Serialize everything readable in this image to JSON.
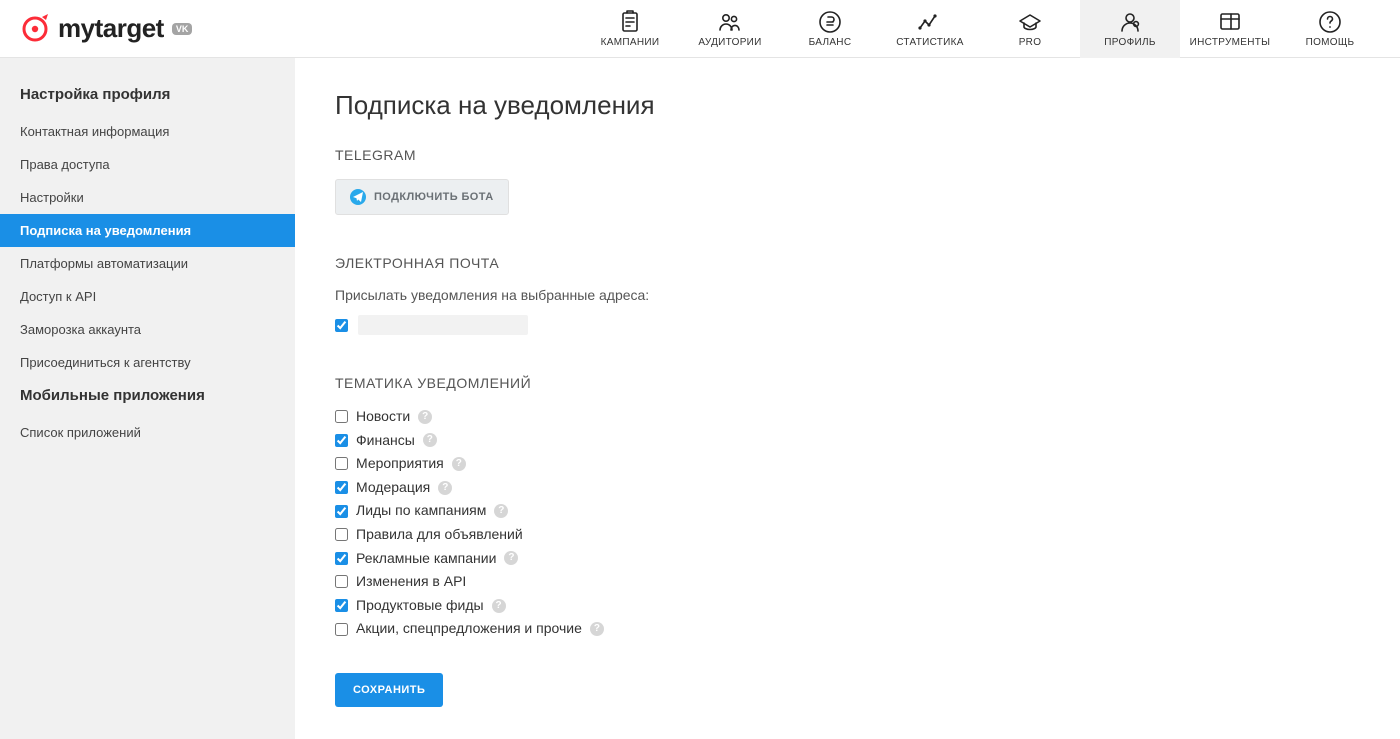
{
  "brand": {
    "name": "mytarget",
    "vk_badge": "VK"
  },
  "topnav": {
    "items": [
      {
        "key": "campaigns",
        "label": "КАМПАНИИ"
      },
      {
        "key": "audiences",
        "label": "АУДИТОРИИ"
      },
      {
        "key": "balance",
        "label": "БАЛАНС"
      },
      {
        "key": "stats",
        "label": "СТАТИСТИКА"
      },
      {
        "key": "pro",
        "label": "PRO"
      },
      {
        "key": "profile",
        "label": "ПРОФИЛЬ"
      },
      {
        "key": "tools",
        "label": "ИНСТРУМЕНТЫ"
      },
      {
        "key": "help",
        "label": "ПОМОЩЬ"
      }
    ],
    "active_key": "profile"
  },
  "sidebar": {
    "heading1": "Настройка профиля",
    "items1": [
      "Контактная информация",
      "Права доступа",
      "Настройки",
      "Подписка на уведомления",
      "Платформы автоматизации",
      "Доступ к API",
      "Заморозка аккаунта",
      "Присоединиться к агентству"
    ],
    "active_index1": 3,
    "heading2": "Мобильные приложения",
    "items2": [
      "Список приложений"
    ]
  },
  "page": {
    "title": "Подписка на уведомления",
    "telegram": {
      "title": "TELEGRAM",
      "button": "ПОДКЛЮЧИТЬ БОТА"
    },
    "email": {
      "title": "ЭЛЕКТРОННАЯ ПОЧТА",
      "hint": "Присылать уведомления на выбранные адреса:",
      "address_checked": true
    },
    "topics": {
      "title": "ТЕМАТИКА УВЕДОМЛЕНИЙ",
      "items": [
        {
          "label": "Новости",
          "checked": false,
          "help": true
        },
        {
          "label": "Финансы",
          "checked": true,
          "help": true
        },
        {
          "label": "Мероприятия",
          "checked": false,
          "help": true
        },
        {
          "label": "Модерация",
          "checked": true,
          "help": true
        },
        {
          "label": "Лиды по кампаниям",
          "checked": true,
          "help": true
        },
        {
          "label": "Правила для объявлений",
          "checked": false,
          "help": false
        },
        {
          "label": "Рекламные кампании",
          "checked": true,
          "help": true
        },
        {
          "label": "Изменения в API",
          "checked": false,
          "help": false
        },
        {
          "label": "Продуктовые фиды",
          "checked": true,
          "help": true
        },
        {
          "label": "Акции, спецпредложения и прочие",
          "checked": false,
          "help": true
        }
      ]
    },
    "save": "СОХРАНИТЬ"
  }
}
